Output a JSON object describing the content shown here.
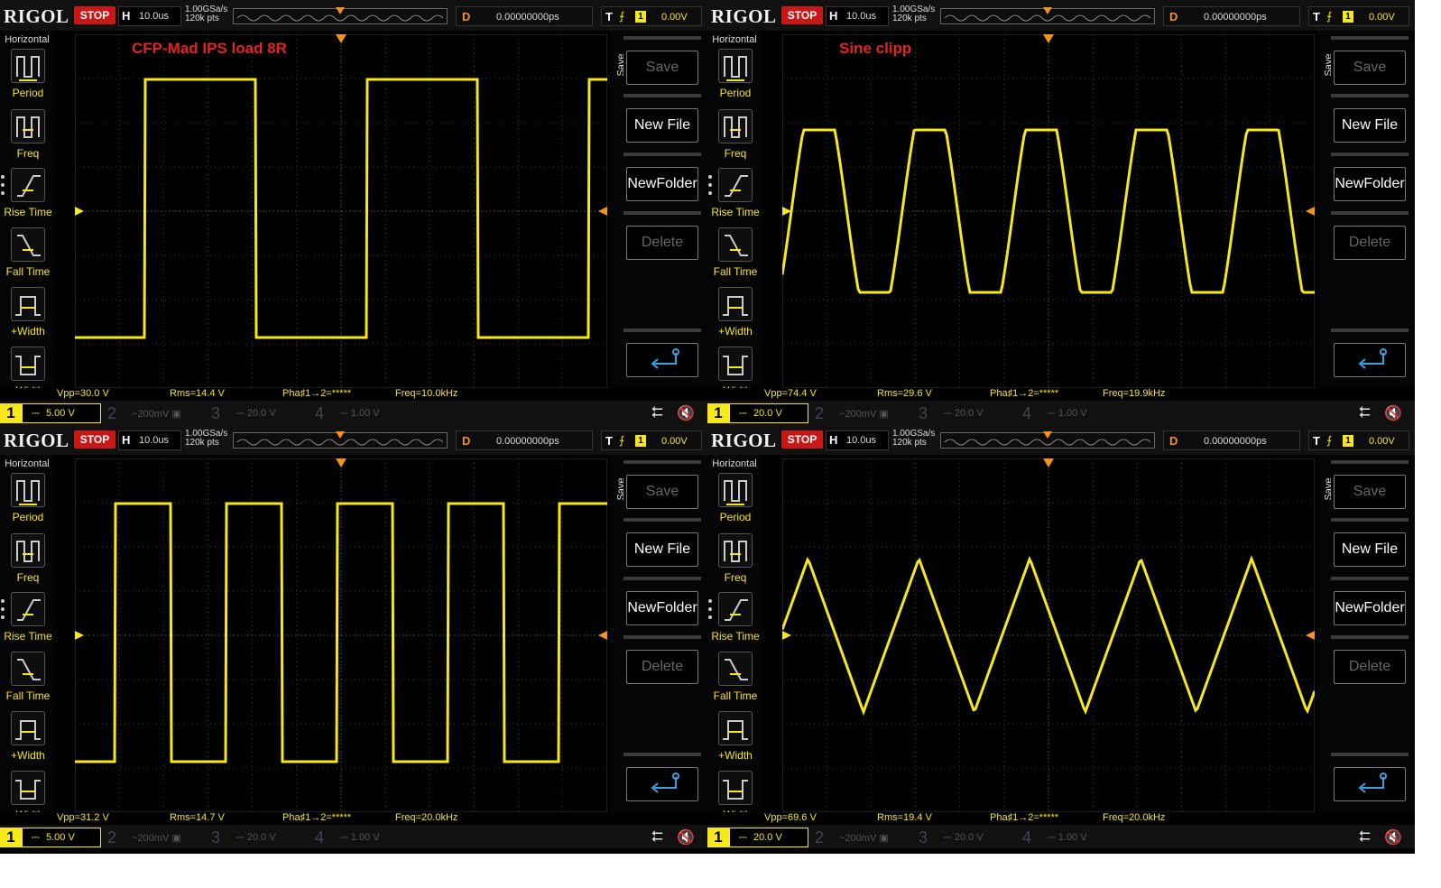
{
  "common": {
    "logo": "RIGOL",
    "status": "STOP",
    "h_label": "H",
    "timebase": "10.0us",
    "sample_rate": "1.00GSa/s",
    "mem_depth": "120k pts",
    "d_label": "D",
    "delay": "0.00000000ps",
    "t_label": "T",
    "t_edge": "⨍",
    "t_ch": "1",
    "t_level": "0.00V",
    "horizontal_title": "Horizontal",
    "measure_items": [
      "Period",
      "Freq",
      "Rise Time",
      "Fall Time",
      "+Width",
      "-Width"
    ],
    "save_title": "Save",
    "save_btn": "Save",
    "newfile_btn": "New File",
    "newfolder_btn": "NewFolder",
    "delete_btn": "Delete",
    "phase_text": "Pha♯1→2=*****",
    "ch1_num": "1",
    "ch2_num": "2",
    "ch2_val": "200mV",
    "ch3_num": "3",
    "ch3_val": "20.0 V",
    "ch4_num": "4",
    "ch4_val": "1.00 V",
    "colors": {
      "trace": "#f6e81a",
      "trigger_marker": "#f39221",
      "stop": "#c81818",
      "annotation": "#e02424"
    }
  },
  "scopes": [
    {
      "annotation": "CFP-Mad IPS load 8R",
      "vpp": "Vpp=30.0 V",
      "rms": "Rms=14.4 V",
      "freq": "Freq=10.0kHz",
      "ch1_scale": "5.00 V",
      "waveform": "square",
      "period_divs": 5
    },
    {
      "annotation": "Sine clipp",
      "vpp": "Vpp=74.4 V",
      "rms": "Rms=29.6 V",
      "freq": "Freq=19.9kHz",
      "ch1_scale": "20.0 V",
      "waveform": "clipped-sine",
      "period_divs": 2.5
    },
    {
      "annotation": "",
      "vpp": "Vpp=31.2 V",
      "rms": "Rms=14.7 V",
      "freq": "Freq=20.0kHz",
      "ch1_scale": "5.00 V",
      "waveform": "square",
      "period_divs": 2.5
    },
    {
      "annotation": "",
      "vpp": "Vpp=69.6 V",
      "rms": "Rms=19.4 V",
      "freq": "Freq=20.0kHz",
      "ch1_scale": "20.0 V",
      "waveform": "triangle",
      "period_divs": 2.5
    }
  ]
}
